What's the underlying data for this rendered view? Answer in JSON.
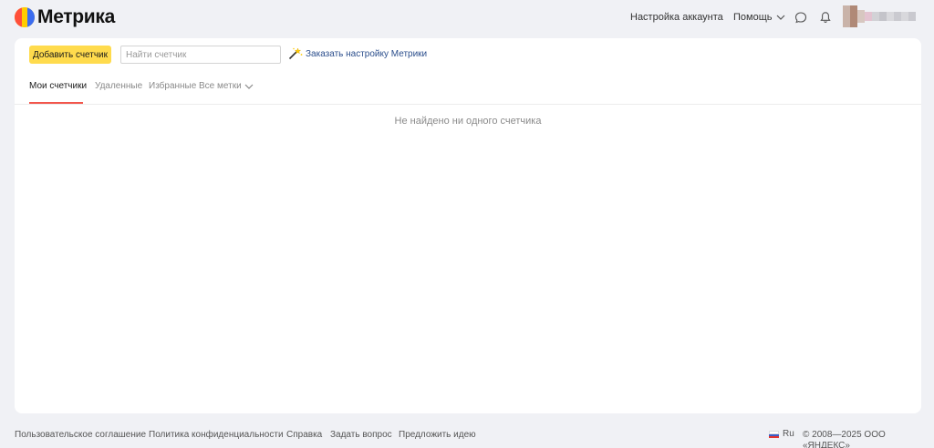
{
  "header": {
    "logo_text": "Метрика",
    "account_settings": "Настройка аккаунта",
    "help": "Помощь"
  },
  "toolbar": {
    "add_counter_label": "Добавить счетчик",
    "search_placeholder": "Найти счетчик",
    "search_value": "",
    "order_setup_label": "Заказать настройку Метрики"
  },
  "tabs": [
    {
      "label": "Мои счетчики",
      "active": true
    },
    {
      "label": "Удаленные",
      "active": false
    },
    {
      "label": "Избранные",
      "active": false
    },
    {
      "label": "Все метки",
      "active": false
    }
  ],
  "empty_message": "Не найдено ни одного счетчика",
  "footer": {
    "links": [
      "Пользовательское соглашение",
      "Политика конфиденциальности",
      "Справка",
      "Задать вопрос",
      "Предложить идею"
    ],
    "language": "Ru",
    "copyright": "© 2008—2025 ООО «ЯНДЕКС»"
  },
  "colors": {
    "background": "#f0f1f5",
    "primary_button": "#ffdb4d",
    "active_tab_underline": "#f2564c",
    "link": "#2b4e8c"
  },
  "icons": [
    "metrica-logo-icon",
    "chevron-down-icon",
    "chat-icon",
    "bell-icon",
    "magic-wand-icon",
    "flag-ru-icon"
  ]
}
